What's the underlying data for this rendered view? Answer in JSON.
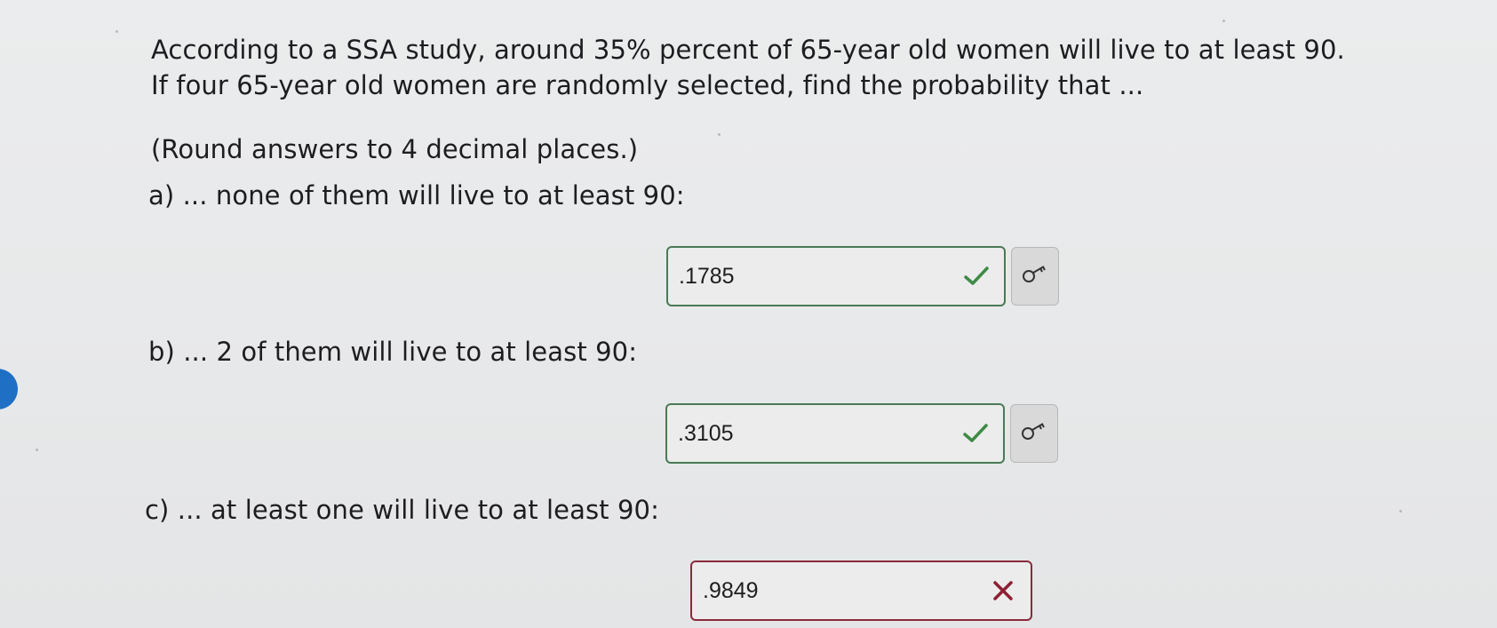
{
  "question": {
    "line1": "According to a SSA study, around 35% percent of 65-year old women will live to at least 90.",
    "line2": "If four 65-year old women are randomly selected, find the probability that ...",
    "instruction": "(Round answers to 4 decimal places.)"
  },
  "parts": [
    {
      "label": "a) ... none of them will live to at least 90:",
      "answer": ".1785",
      "status": "correct",
      "status_icon": "checkmark-icon",
      "has_key_button": true
    },
    {
      "label": "b) ... 2 of them will live to at least 90:",
      "answer": ".3105",
      "status": "correct",
      "status_icon": "checkmark-icon",
      "has_key_button": true
    },
    {
      "label": "c) ... at least one will live to at least 90:",
      "answer": ".9849",
      "status": "incorrect",
      "status_icon": "x-mark-icon",
      "has_key_button": false
    }
  ],
  "key_button_icon": "key-icon",
  "colors": {
    "correct_border": "#4a7a55",
    "correct_check": "#3f8a46",
    "wrong_border": "#8a2a3a",
    "wrong_x": "#8e1f33",
    "side_tab": "#1f6fc4"
  }
}
